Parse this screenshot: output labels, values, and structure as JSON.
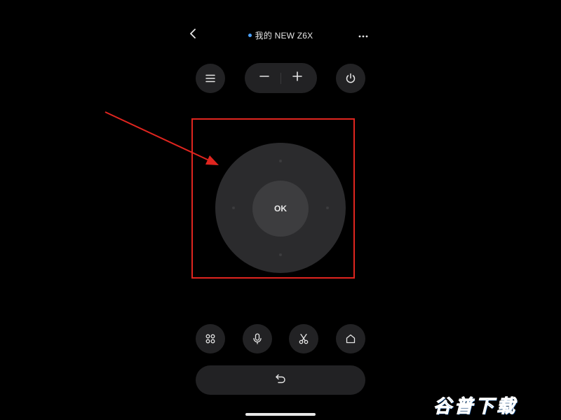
{
  "header": {
    "device_name": "我的 NEW Z6X",
    "back_icon": "chevron-left-icon",
    "more_icon": "ellipsis-icon",
    "status_dot_color": "#4da3ff"
  },
  "top_controls": {
    "menu_icon": "menu-icon",
    "volume_down_icon": "minus-icon",
    "volume_up_icon": "plus-icon",
    "power_icon": "power-icon"
  },
  "dpad": {
    "ok_label": "OK"
  },
  "bottom_controls": {
    "apps_icon": "grid-icon",
    "voice_icon": "microphone-icon",
    "cut_icon": "scissors-icon",
    "home_icon": "home-icon",
    "back_icon": "return-arrow-icon"
  },
  "annotation": {
    "highlight_color": "#e0251f"
  },
  "watermark": {
    "text": "谷普下载"
  }
}
